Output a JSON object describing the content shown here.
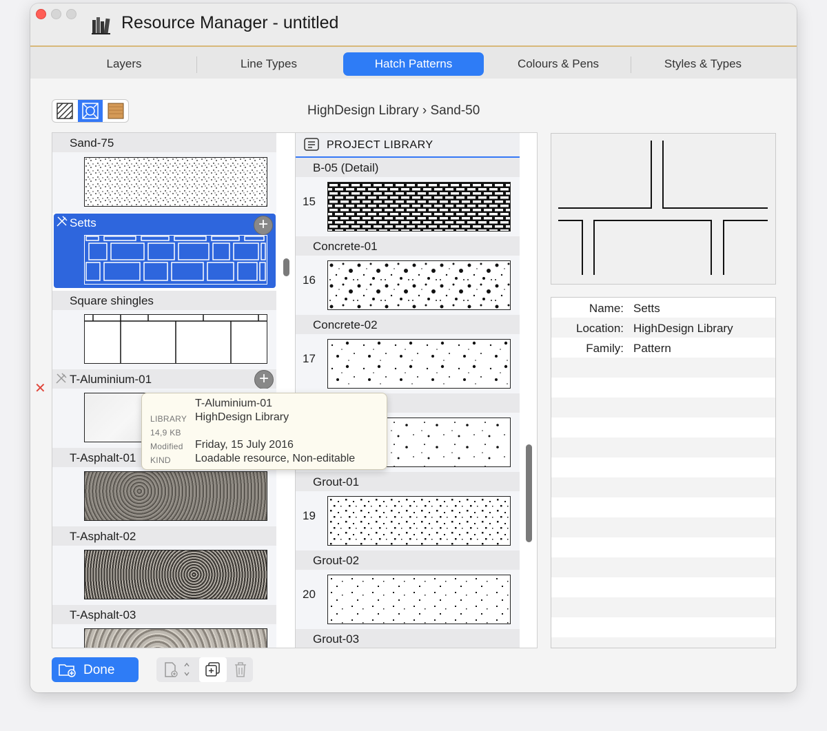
{
  "window": {
    "title": "Resource Manager - untitled"
  },
  "tabs": [
    {
      "label": "Layers"
    },
    {
      "label": "Line Types"
    },
    {
      "label": "Hatch Patterns",
      "active": true
    },
    {
      "label": "Colours & Pens"
    },
    {
      "label": "Styles & Types"
    }
  ],
  "view_modes": [
    "hatch-icon",
    "pattern-icon",
    "texture-icon"
  ],
  "breadcrumb": "HighDesign Library › Sand-50",
  "library_list": {
    "items": [
      {
        "label": "Sand-75"
      },
      {
        "label": "Setts",
        "selected": true
      },
      {
        "label": "Square shingles"
      },
      {
        "label": "T-Aluminium-01"
      },
      {
        "label": "T-Asphalt-01"
      },
      {
        "label": "T-Asphalt-02"
      },
      {
        "label": "T-Asphalt-03"
      }
    ]
  },
  "tooltip": {
    "title": "T-Aluminium-01",
    "library_key": "LIBRARY",
    "library_val": "HighDesign Library",
    "size": "14,9 KB",
    "modified_key": "Modified",
    "modified_val": "Friday, 15 July 2016",
    "kind_key": "KIND",
    "kind_val": "Loadable resource, Non-editable"
  },
  "project_library": {
    "title": "PROJECT LIBRARY",
    "items": [
      {
        "label": "B-05 (Detail)",
        "number": "15"
      },
      {
        "label": "Concrete-01",
        "number": "16"
      },
      {
        "label": "Concrete-02",
        "number": "17"
      },
      {
        "label": "",
        "number": ""
      },
      {
        "label": "Grout-01",
        "number": "19"
      },
      {
        "label": "Grout-02",
        "number": "20"
      },
      {
        "label": "Grout-03",
        "number": ""
      }
    ]
  },
  "properties": {
    "name_key": "Name:",
    "name_val": "Setts",
    "location_key": "Location:",
    "location_val": "HighDesign Library",
    "family_key": "Family:",
    "family_val": "Pattern"
  },
  "footer": {
    "done_label": "Done"
  },
  "colors": {
    "accent": "#2e7cf6",
    "selection": "#2e66dd",
    "delete": "#e0463b"
  }
}
